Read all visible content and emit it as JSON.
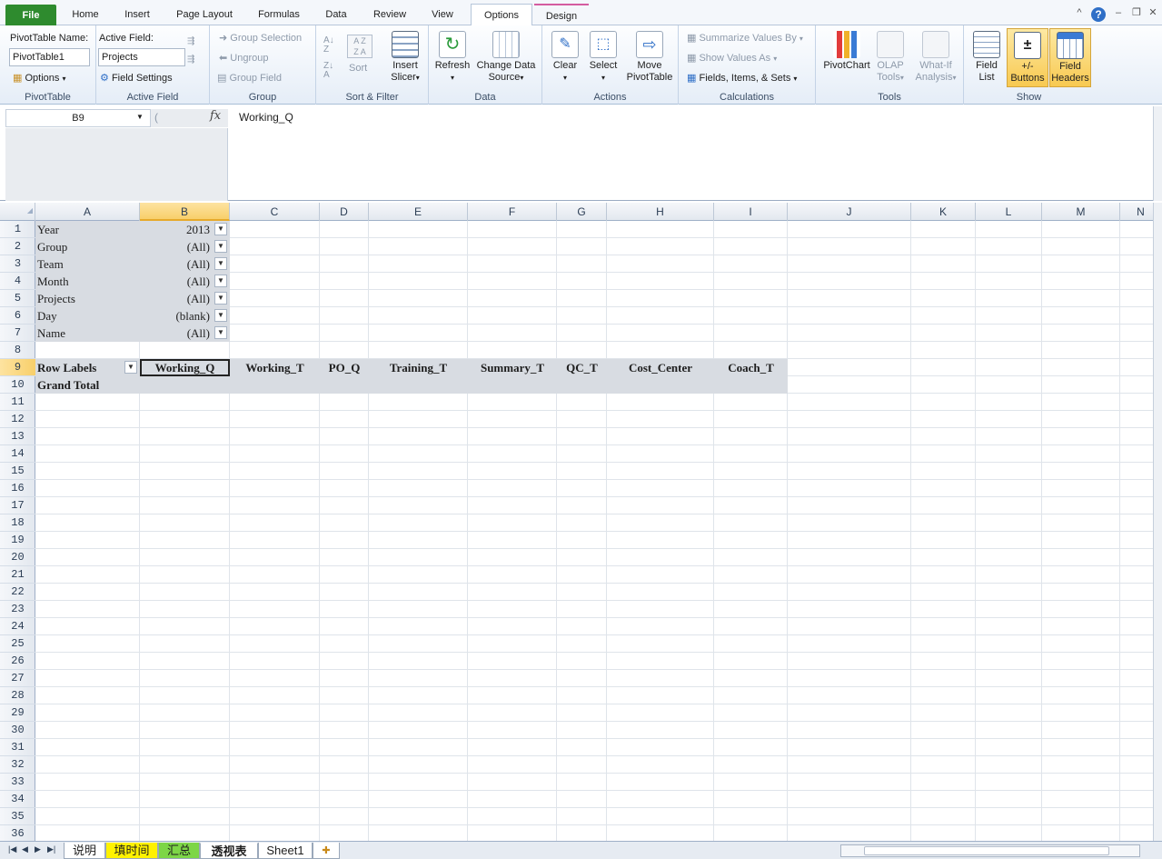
{
  "tabs": {
    "file": "File",
    "home": "Home",
    "insert": "Insert",
    "page_layout": "Page Layout",
    "formulas": "Formulas",
    "data": "Data",
    "review": "Review",
    "view": "View",
    "options": "Options",
    "design": "Design"
  },
  "ribbon": {
    "pivottable": {
      "name_label": "PivotTable Name:",
      "name_value": "PivotTable1",
      "options": "Options",
      "group": "PivotTable"
    },
    "active_field": {
      "label": "Active Field:",
      "value": "Projects",
      "settings": "Field Settings",
      "group": "Active Field"
    },
    "group": {
      "selection": "Group Selection",
      "ungroup": "Ungroup",
      "field": "Group Field",
      "group": "Group"
    },
    "sort": {
      "sort": "Sort",
      "group": "Sort & Filter"
    },
    "slicer": {
      "line1": "Insert",
      "line2": "Slicer"
    },
    "data": {
      "refresh": "Refresh",
      "change1": "Change Data",
      "change2": "Source",
      "group": "Data"
    },
    "actions": {
      "clear": "Clear",
      "select": "Select",
      "move1": "Move",
      "move2": "PivotTable",
      "group": "Actions"
    },
    "calc": {
      "summarize": "Summarize Values By",
      "show": "Show Values As",
      "fields": "Fields, Items, & Sets",
      "group": "Calculations"
    },
    "tools": {
      "pivotchart": "PivotChart",
      "olap1": "OLAP",
      "olap2": "Tools",
      "whatif1": "What-If",
      "whatif2": "Analysis",
      "group": "Tools"
    },
    "show": {
      "fieldlist1": "Field",
      "fieldlist2": "List",
      "buttons1": "+/-",
      "buttons2": "Buttons",
      "headers1": "Field",
      "headers2": "Headers",
      "group": "Show"
    }
  },
  "formula_bar": {
    "name_box": "B9",
    "fx": "fx",
    "content": "Working_Q"
  },
  "columns": [
    "A",
    "B",
    "C",
    "D",
    "E",
    "F",
    "G",
    "H",
    "I",
    "J",
    "K",
    "L",
    "M",
    "N"
  ],
  "rows": [
    "1",
    "2",
    "3",
    "4",
    "5",
    "6",
    "7",
    "8",
    "9",
    "10",
    "11",
    "12",
    "13",
    "14",
    "15",
    "16",
    "17",
    "18",
    "19",
    "20",
    "21",
    "22",
    "23",
    "24",
    "25",
    "26",
    "27",
    "28",
    "29",
    "30",
    "31",
    "32",
    "33",
    "34",
    "35",
    "36"
  ],
  "filters": [
    {
      "field": "Year",
      "value": "2013"
    },
    {
      "field": "Group",
      "value": "(All)"
    },
    {
      "field": "Team",
      "value": "(All)"
    },
    {
      "field": "Month",
      "value": "(All)"
    },
    {
      "field": "Projects",
      "value": "(All)"
    },
    {
      "field": "Day",
      "value": "(blank)"
    },
    {
      "field": "Name",
      "value": "(All)"
    }
  ],
  "pivot": {
    "row_labels": "Row Labels",
    "headers": [
      "Working_Q",
      "Working_T",
      "PO_Q",
      "Training_T",
      "Summary_T",
      "QC_T",
      "Cost_Center",
      "Coach_T"
    ],
    "grand_total": "Grand Total"
  },
  "sheets": [
    "说明",
    "填时间",
    "汇总",
    "透视表",
    "Sheet1"
  ]
}
